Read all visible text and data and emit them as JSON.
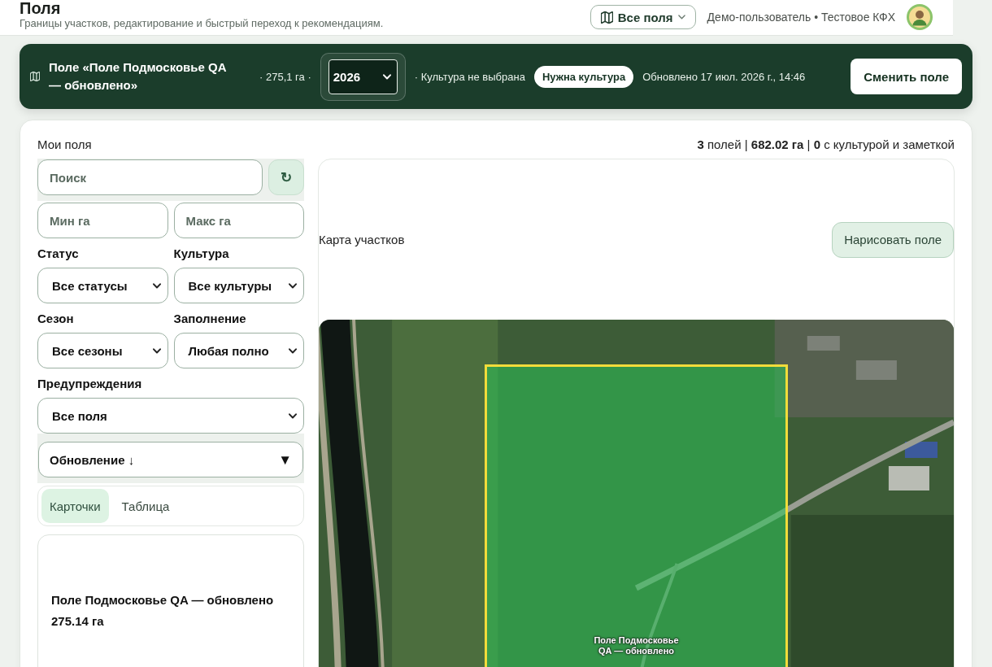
{
  "header": {
    "title": "Поля",
    "subtitle": "Границы участков, редактирование и быстрый переход к рекомендациям.",
    "scope_menu": {
      "label": "Все поля"
    },
    "user": "Демо-пользователь • Тестовое КФХ"
  },
  "banner": {
    "field_name": "Поле «Поле Подмосковье QA — обновлено»",
    "area": "· 275,1 га ·",
    "season": {
      "value": "2026"
    },
    "crop_status": "· Культура не выбрана",
    "badge": "Нужна культура",
    "updated": "Обновлено 17 июл. 2026 г., 14:46",
    "action": "Сменить поле"
  },
  "fields_panel": {
    "title": "Мои поля",
    "summary": "**3** полей | **682.02 га** | **0** с культурой и заметкой"
  },
  "filters": {
    "search": {
      "placeholder": "Поиск"
    },
    "refresh": "↻",
    "min_area": {
      "placeholder": "Мин га"
    },
    "max_area": {
      "placeholder": "Макс га"
    },
    "selects": [
      {
        "label": "Статус",
        "value": "Все статусы"
      },
      {
        "label": "Культура",
        "value": "Все культуры"
      },
      {
        "label": "Сезон",
        "value": "Все сезоны"
      },
      {
        "label": "Заполнение",
        "value": "Любая полно"
      }
    ],
    "warnings": {
      "label": "Предупреждения",
      "value": "Все поля"
    },
    "sort": {
      "value": "Обновление ↓",
      "caret": "▼"
    }
  },
  "view_tabs": [
    {
      "label": "Карточки",
      "selected": true
    },
    {
      "label": "Таблица",
      "selected": false
    }
  ],
  "field_cards": [
    {
      "name": "Поле Подмосковье QA — обновлено",
      "area": "275.14 га"
    }
  ],
  "map": {
    "title": "Карта участков",
    "draw_button": "Нарисовать поле",
    "polygons": [
      {
        "label": "Поле Подмосковье QA — обновлено"
      }
    ]
  }
}
